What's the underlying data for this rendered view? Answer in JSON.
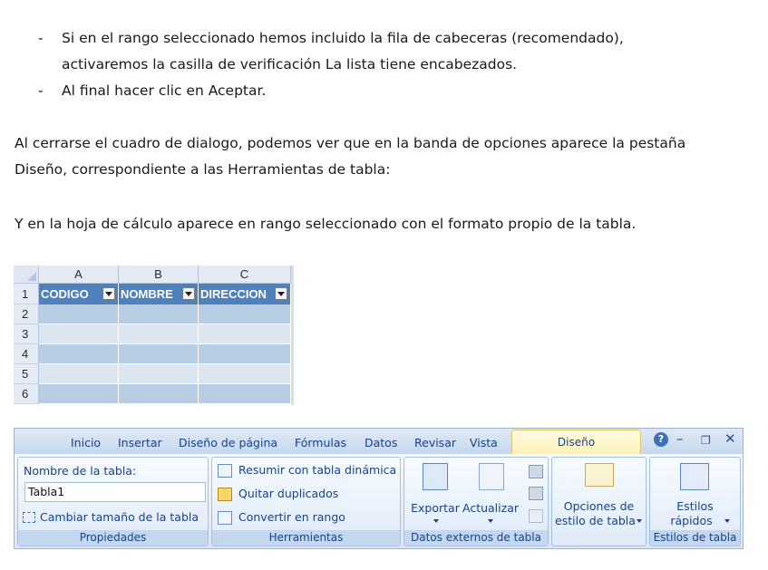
{
  "bullets": [
    {
      "dash": "-",
      "line1": "Si en el rango seleccionado hemos incluido la fila de cabeceras (recomendado),",
      "line2": "activaremos la casilla de verificación La lista tiene encabezados."
    },
    {
      "dash": "-",
      "line1": "Al final hacer clic en Aceptar."
    }
  ],
  "paragraph1": {
    "line1": "Al cerrarse el cuadro de dialogo, podemos ver que en la banda de opciones aparece la pestaña",
    "line2": "Diseño, correspondiente a las Herramientas de tabla:"
  },
  "paragraph2": "Y en la hoja de cálculo aparece en rango seleccionado con el formato propio de la tabla.",
  "sheet": {
    "columns": [
      "A",
      "B",
      "C"
    ],
    "header_row_number": "1",
    "headers": [
      "CODIGO",
      "NOMBRE",
      "DIRECCION"
    ],
    "rows": [
      "2",
      "3",
      "4",
      "5",
      "6"
    ]
  },
  "ribbon": {
    "tabs": [
      "Inicio",
      "Insertar",
      "Diseño de página",
      "Fórmulas",
      "Datos",
      "Revisar",
      "Vista"
    ],
    "active_tab": "Diseño",
    "window_controls": {
      "help": "?",
      "minimize": "–",
      "restore": "❐",
      "close": "✕"
    },
    "groups": {
      "propiedades": {
        "table_name_label": "Nombre de la tabla:",
        "table_name_value": "Tabla1",
        "resize_label": "Cambiar tamaño de la tabla",
        "group_label": "Propiedades"
      },
      "herramientas": {
        "summarize": "Resumir con tabla dinámica",
        "remove_duplicates": "Quitar duplicados",
        "convert_range": "Convertir en rango",
        "group_label": "Herramientas"
      },
      "datos_externos": {
        "export": "Exportar",
        "refresh": "Actualizar",
        "group_label": "Datos externos de tabla"
      },
      "opciones": {
        "line1": "Opciones de",
        "line2": "estilo de tabla"
      },
      "estilos": {
        "line1": "Estilos",
        "line2": "rápidos",
        "group_label": "Estilos de tabla"
      }
    },
    "colors": {
      "header_fill": "#4f81bd",
      "band_dark": "#b8cce4",
      "band_light": "#dce6f1",
      "active_tab": "#fdf0b8",
      "ribbon_text": "#15428b"
    }
  }
}
